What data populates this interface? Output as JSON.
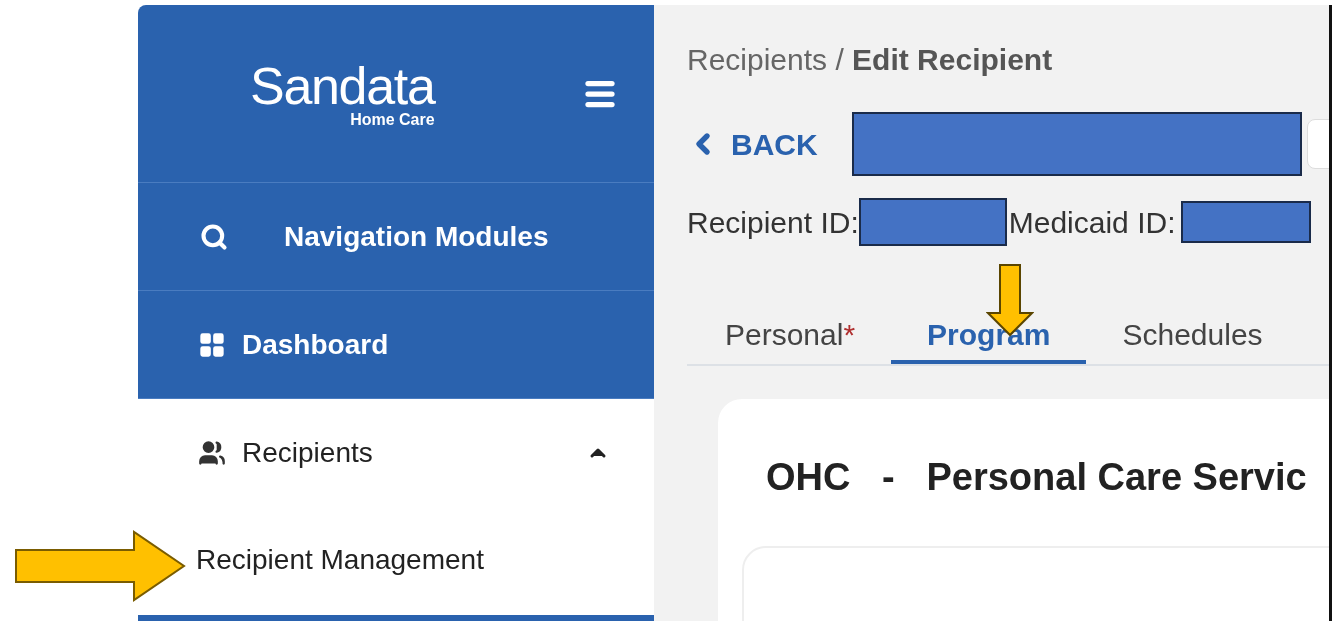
{
  "sidebar": {
    "logo": {
      "name": "Sandata",
      "subtitle": "Home Care"
    },
    "items": [
      {
        "kind": "search",
        "label": "Navigation Modules"
      },
      {
        "kind": "dashboard",
        "label": "Dashboard"
      },
      {
        "kind": "group",
        "label": "Recipients",
        "expanded": true,
        "children": [
          {
            "label": "Recipient Management"
          }
        ]
      }
    ]
  },
  "breadcrumb": {
    "parent": "Recipients",
    "separator": "/",
    "current": "Edit Recipient"
  },
  "back": {
    "label": "BACK"
  },
  "ids": [
    {
      "label": "Recipient ID:"
    },
    {
      "label": "Medicaid ID:"
    }
  ],
  "tabs": [
    {
      "label": "Personal",
      "required_mark": "*",
      "selected": false
    },
    {
      "label": "Program",
      "selected": true
    },
    {
      "label": "Schedules",
      "selected": false
    }
  ],
  "card": {
    "title": "OHC   -   Personal Care Servic"
  }
}
